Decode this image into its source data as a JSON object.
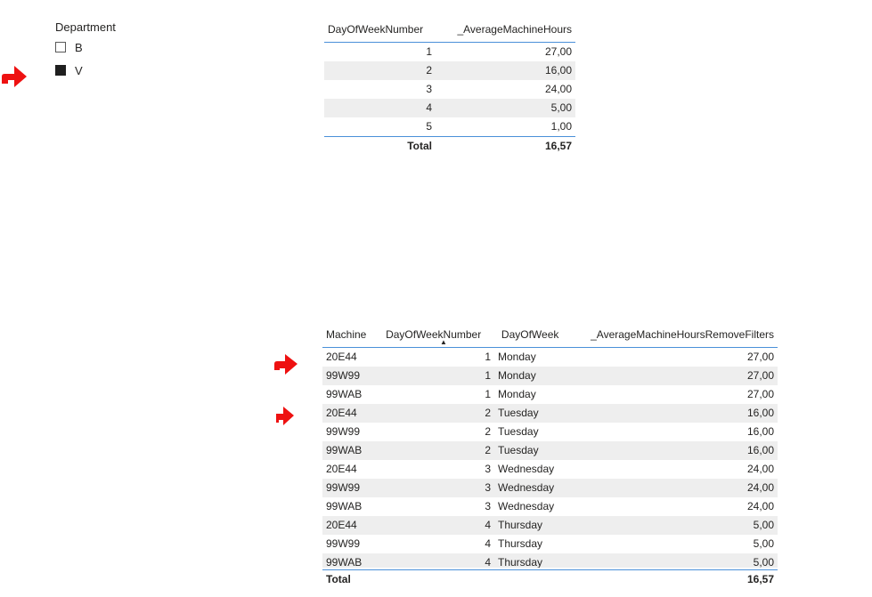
{
  "slicer": {
    "title": "Department",
    "items": [
      {
        "label": "B",
        "checked": false
      },
      {
        "label": "V",
        "checked": true
      }
    ]
  },
  "table1": {
    "headers": [
      "DayOfWeekNumber",
      "_AverageMachineHours"
    ],
    "rows": [
      [
        "1",
        "27,00"
      ],
      [
        "2",
        "16,00"
      ],
      [
        "3",
        "24,00"
      ],
      [
        "4",
        "5,00"
      ],
      [
        "5",
        "1,00"
      ]
    ],
    "total_label": "Total",
    "total_value": "16,57"
  },
  "table2": {
    "headers": [
      "Machine",
      "DayOfWeekNumber",
      "DayOfWeek",
      "_AverageMachineHoursRemoveFilters"
    ],
    "sort_icon": "sort-ascending-icon",
    "rows": [
      [
        "20E44",
        "1",
        "Monday",
        "27,00"
      ],
      [
        "99W99",
        "1",
        "Monday",
        "27,00"
      ],
      [
        "99WAB",
        "1",
        "Monday",
        "27,00"
      ],
      [
        "20E44",
        "2",
        "Tuesday",
        "16,00"
      ],
      [
        "99W99",
        "2",
        "Tuesday",
        "16,00"
      ],
      [
        "99WAB",
        "2",
        "Tuesday",
        "16,00"
      ],
      [
        "20E44",
        "3",
        "Wednesday",
        "24,00"
      ],
      [
        "99W99",
        "3",
        "Wednesday",
        "24,00"
      ],
      [
        "99WAB",
        "3",
        "Wednesday",
        "24,00"
      ],
      [
        "20E44",
        "4",
        "Thursday",
        "5,00"
      ],
      [
        "99W99",
        "4",
        "Thursday",
        "5,00"
      ],
      [
        "99WAB",
        "4",
        "Thursday",
        "5,00"
      ]
    ],
    "total_label": "Total",
    "total_value": "16,57"
  },
  "colors": {
    "arrow": "#ee1111",
    "accent_line": "#4a90d9",
    "row_alt": "#eeeeee"
  }
}
